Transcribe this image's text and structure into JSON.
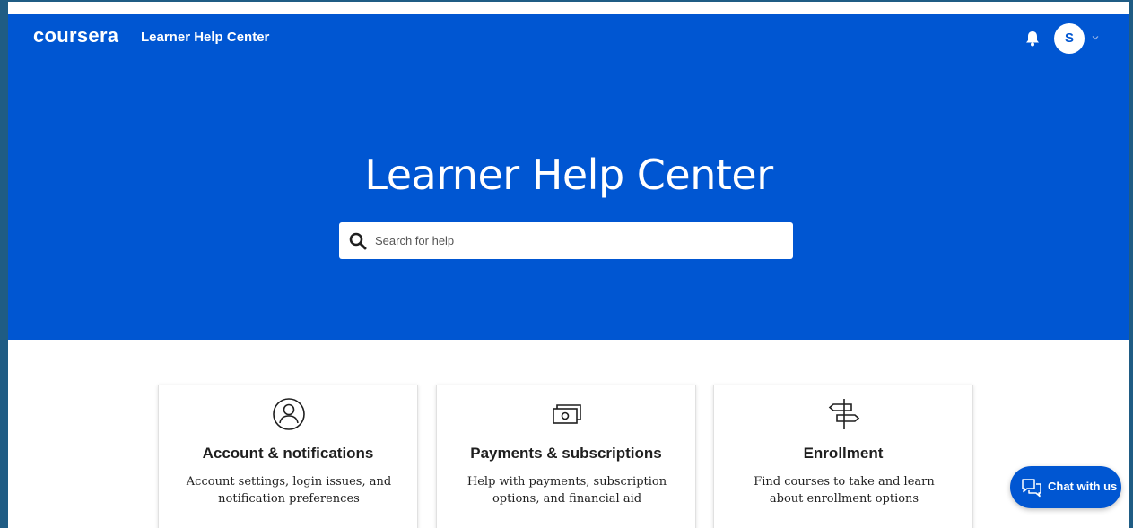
{
  "header": {
    "logo_text": "coursera",
    "site_name": "Learner Help Center",
    "avatar_initial": "S"
  },
  "hero": {
    "title": "Learner Help Center"
  },
  "search": {
    "placeholder": "Search for help"
  },
  "cards": [
    {
      "icon": "user-circle-icon",
      "title": "Account & notifications",
      "description": "Account settings, login issues, and notification preferences"
    },
    {
      "icon": "money-bills-icon",
      "title": "Payments & subscriptions",
      "description": "Help with payments, subscription options, and financial aid"
    },
    {
      "icon": "signpost-icon",
      "title": "Enrollment",
      "description": "Find courses to take and learn about enrollment options"
    }
  ],
  "chat": {
    "label": "Chat with us"
  },
  "colors": {
    "brand_blue": "#0056d2",
    "frame_border": "#1f5c84",
    "text_dark": "#1f1f1f"
  }
}
